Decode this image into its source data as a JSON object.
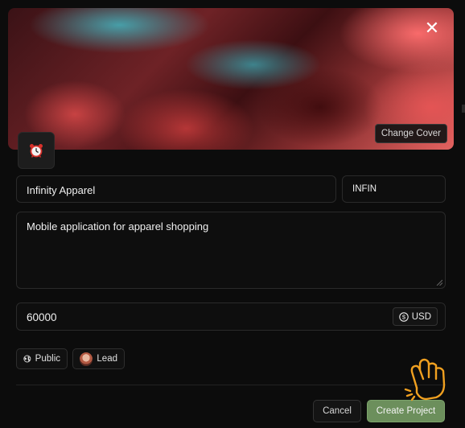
{
  "cover": {
    "change_cover_label": "Change Cover",
    "close_icon": "close-icon"
  },
  "project": {
    "icon": "alarm-clock-icon",
    "name": "Infinity Apparel",
    "key": "INFIN",
    "description": "Mobile application for apparel shopping",
    "budget": "60000",
    "currency": "USD"
  },
  "chips": {
    "visibility": "Public",
    "lead": "Lead"
  },
  "actions": {
    "cancel": "Cancel",
    "create": "Create Project"
  },
  "colors": {
    "create_button": "#6c8f5c",
    "background": "#0c0c0c"
  }
}
